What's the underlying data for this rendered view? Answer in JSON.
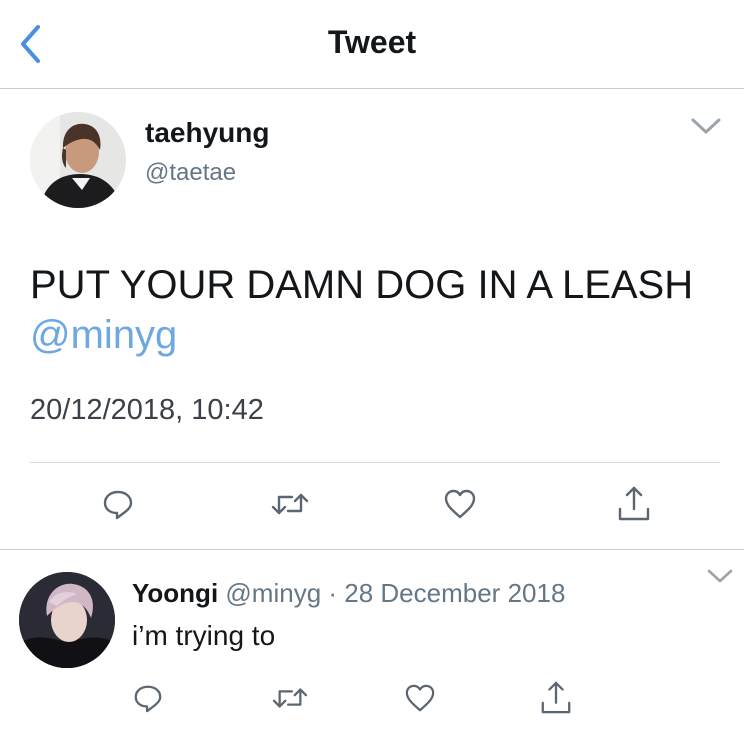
{
  "header": {
    "title": "Tweet",
    "back_icon": "chevron-left-icon",
    "accent": "#4a90e2"
  },
  "tweet": {
    "author_name": "taehyung",
    "author_handle": "@taetae",
    "text": "PUT YOUR DAMN DOG IN A LEASH ",
    "mention": "@minyg",
    "timestamp": "20/12/2018, 10:42",
    "actions": [
      "reply-icon",
      "retweet-icon",
      "like-icon",
      "share-icon"
    ]
  },
  "reply": {
    "author_name": "Yoongi",
    "author_handle": "@minyg",
    "separator": " · ",
    "date": "28 December 2018",
    "text": "i’m trying to",
    "actions": [
      "reply-icon",
      "retweet-icon",
      "like-icon",
      "share-icon"
    ]
  },
  "colors": {
    "text": "#14171a",
    "secondary": "#657786",
    "mention": "#6fa8e0",
    "divider": "#c8ccd0",
    "icon": "#5b6670"
  }
}
